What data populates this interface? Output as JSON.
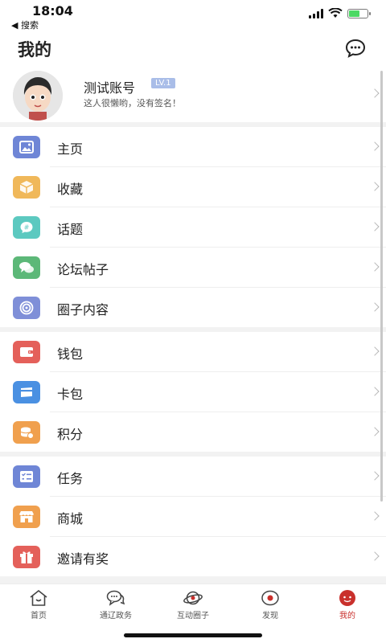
{
  "status_bar": {
    "time": "18:04",
    "back_label": "◀ 搜索"
  },
  "header": {
    "title": "我的",
    "message_icon": "chat-bubble-icon"
  },
  "profile": {
    "name": "测试账号",
    "level": "LV.1",
    "signature": "这人很懒哟，没有签名！",
    "avatar_icon": "cartoon-avatar"
  },
  "menu_groups": [
    [
      {
        "label": "主页",
        "icon": "image-icon",
        "color": "#6f86d6"
      },
      {
        "label": "收藏",
        "icon": "box-icon",
        "color": "#f0b85a"
      },
      {
        "label": "话题",
        "icon": "hashtag-bubble-icon",
        "color": "#5cc9c0"
      },
      {
        "label": "论坛帖子",
        "icon": "speech-bubbles-icon",
        "color": "#5cb878"
      },
      {
        "label": "圈子内容",
        "icon": "swirl-icon",
        "color": "#7f8fd8"
      }
    ],
    [
      {
        "label": "钱包",
        "icon": "wallet-icon",
        "color": "#e4605a"
      },
      {
        "label": "卡包",
        "icon": "card-icon",
        "color": "#4a90e2"
      },
      {
        "label": "积分",
        "icon": "coins-icon",
        "color": "#f0a04e"
      }
    ],
    [
      {
        "label": "任务",
        "icon": "task-list-icon",
        "color": "#6f86d6"
      },
      {
        "label": "商城",
        "icon": "store-icon",
        "color": "#f0a04e"
      },
      {
        "label": "邀请有奖",
        "icon": "gift-icon",
        "color": "#e4605a"
      }
    ]
  ],
  "tabs": [
    {
      "label": "首页",
      "icon": "home-icon"
    },
    {
      "label": "通辽政务",
      "icon": "chat-bubbles-icon"
    },
    {
      "label": "互动圈子",
      "icon": "planet-icon"
    },
    {
      "label": "发现",
      "icon": "discover-icon"
    },
    {
      "label": "我的",
      "icon": "profile-face-icon",
      "active": true
    }
  ],
  "colors": {
    "accent": "#c9302c",
    "level_badge": "#a9bde8"
  }
}
